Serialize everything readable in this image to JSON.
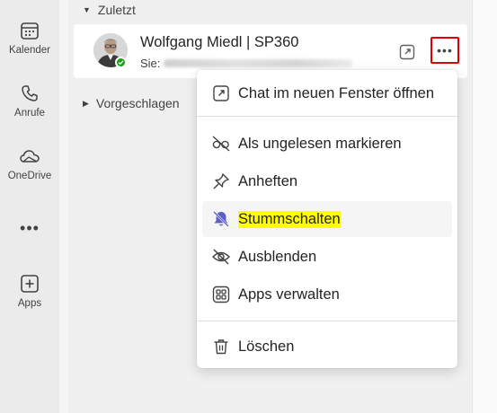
{
  "rail": {
    "items": [
      {
        "label": "Kalender",
        "icon": "calendar-icon"
      },
      {
        "label": "Anrufe",
        "icon": "phone-icon"
      },
      {
        "label": "OneDrive",
        "icon": "cloud-icon"
      },
      {
        "label": "Apps",
        "icon": "add-apps-icon"
      }
    ],
    "more_label": "•••"
  },
  "chat_list": {
    "section_recent": "Zuletzt",
    "section_suggested": "Vorgeschlagen",
    "chat": {
      "name": "Wolfgang Miedl | SP360",
      "preview_label": "Sie:",
      "presence": "available"
    },
    "more_button": "•••"
  },
  "context_menu": {
    "items": [
      {
        "label": "Chat im neuen Fenster öffnen",
        "icon": "open-new-window-icon"
      },
      {
        "label": "Als ungelesen markieren",
        "icon": "mark-unread-icon"
      },
      {
        "label": "Anheften",
        "icon": "pin-icon"
      },
      {
        "label": "Stummschalten",
        "icon": "mute-bell-icon"
      },
      {
        "label": "Ausblenden",
        "icon": "hide-icon"
      },
      {
        "label": "Apps verwalten",
        "icon": "apps-grid-icon"
      },
      {
        "label": "Löschen",
        "icon": "trash-icon"
      }
    ],
    "highlight_color": "#ffff00",
    "mute_icon_color": "#5b5fc7"
  },
  "colors": {
    "presence_available": "#13a10e",
    "callout_border": "#e00000"
  }
}
